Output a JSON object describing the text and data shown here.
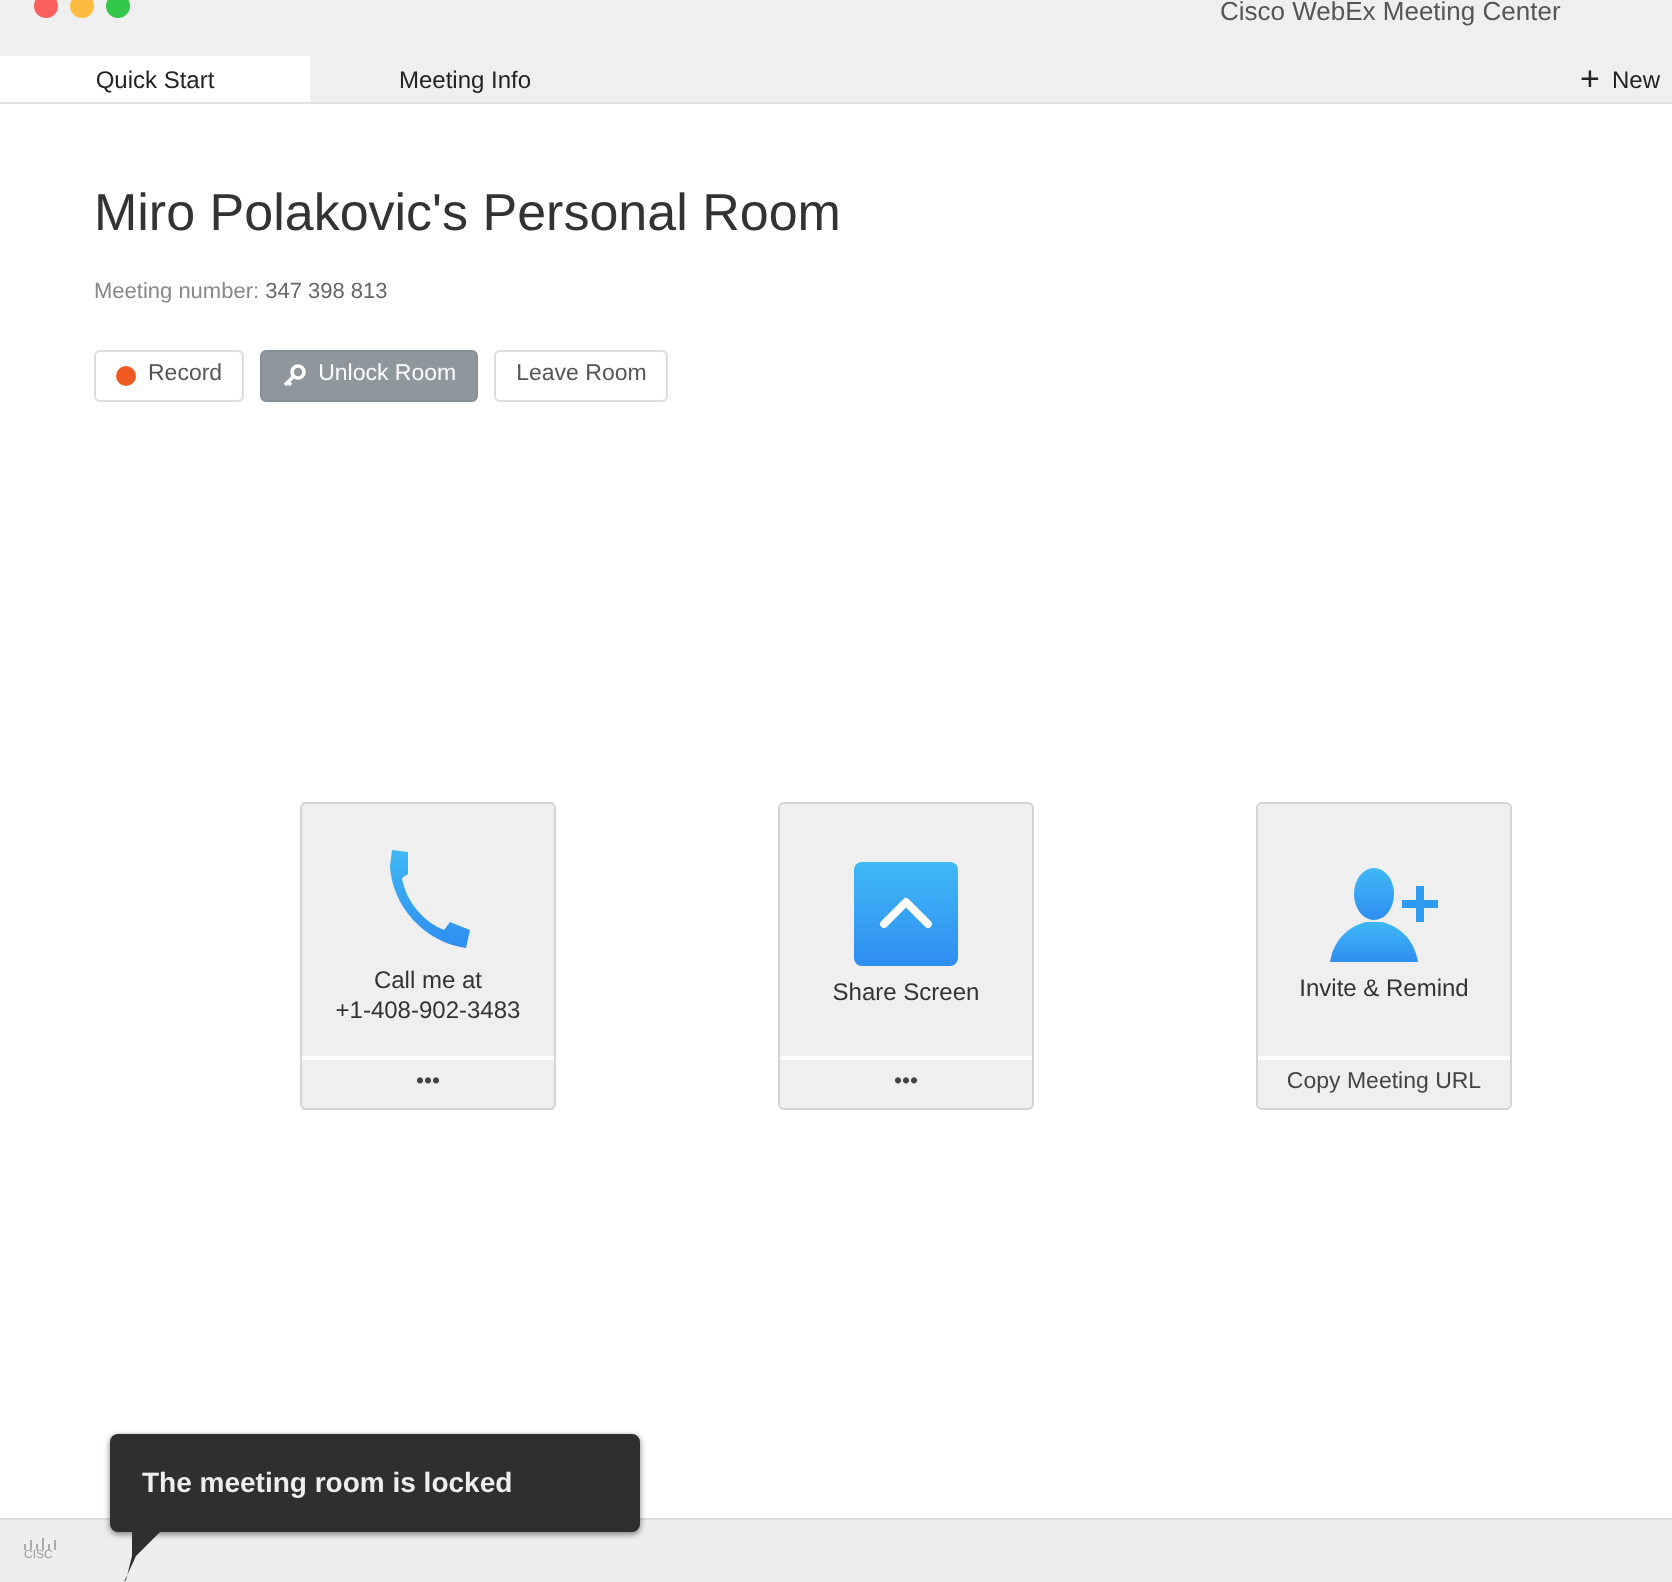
{
  "window": {
    "title": "Cisco WebEx Meeting Center"
  },
  "tabs": [
    {
      "label": "Quick Start",
      "selected": true
    },
    {
      "label": "Meeting Info",
      "selected": false
    }
  ],
  "new_button": {
    "icon": "+",
    "label": "New"
  },
  "room": {
    "title": "Miro Polakovic's Personal Room",
    "meeting_number_label": "Meeting number:",
    "meeting_number": "347 398 813"
  },
  "actions": [
    {
      "kind": "record",
      "label": "Record"
    },
    {
      "kind": "unlock",
      "label": "Unlock Room"
    },
    {
      "kind": "plain",
      "label": "Leave Room"
    }
  ],
  "cards": [
    {
      "kind": "phone",
      "lines": [
        "Call me at",
        "+1-408-902-3483"
      ],
      "footer": "•••"
    },
    {
      "kind": "share",
      "lines": [
        "Share Screen"
      ],
      "footer": "•••"
    },
    {
      "kind": "invite",
      "lines": [
        "Invite & Remind"
      ],
      "footer": "Copy Meeting URL"
    }
  ],
  "status_bar": {
    "logo_text": "CISC"
  },
  "tooltip": {
    "text": "The meeting room is locked"
  }
}
